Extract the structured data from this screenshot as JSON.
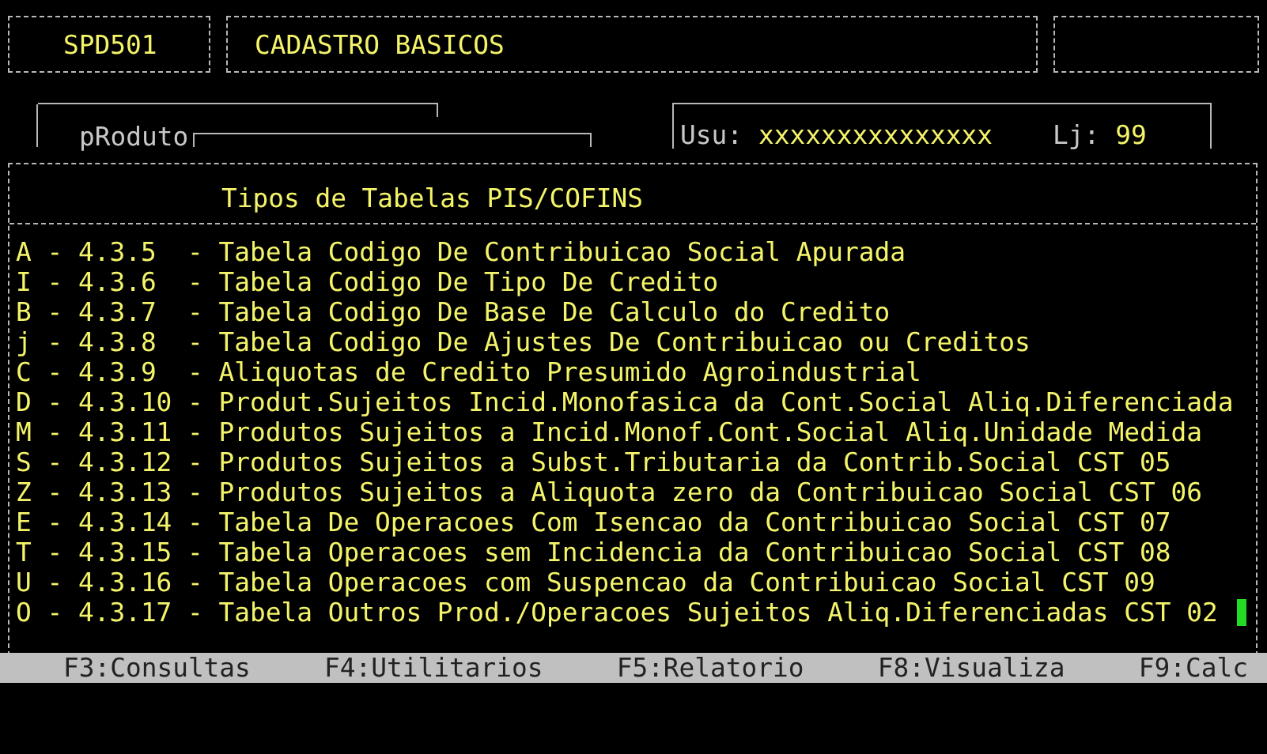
{
  "header": {
    "program_code": "SPD501",
    "screen_title": "CADASTRO BASICOS"
  },
  "product_field": {
    "label": "pRoduto"
  },
  "user_info": {
    "user_label": "Usu:",
    "user": "xxxxxxxxxxxxxxx",
    "store_label": "Lj:",
    "store": "99"
  },
  "menu": {
    "title": "Tipos de Tabelas PIS/COFINS",
    "items": [
      "A - 4.3.5  - Tabela Codigo De Contribuicao Social Apurada",
      "I - 4.3.6  - Tabela Codigo De Tipo De Credito",
      "B - 4.3.7  - Tabela Codigo De Base De Calculo do Credito",
      "j - 4.3.8  - Tabela Codigo De Ajustes De Contribuicao ou Creditos",
      "C - 4.3.9  - Aliquotas de Credito Presumido Agroindustrial",
      "D - 4.3.10 - Produt.Sujeitos Incid.Monofasica da Cont.Social Aliq.Diferenciada",
      "M - 4.3.11 - Produtos Sujeitos a Incid.Monof.Cont.Social Aliq.Unidade Medida",
      "S - 4.3.12 - Produtos Sujeitos a Subst.Tributaria da Contrib.Social CST 05",
      "Z - 4.3.13 - Produtos Sujeitos a Aliquota zero da Contribuicao Social CST 06",
      "E - 4.3.14 - Tabela De Operacoes Com Isencao da Contribuicao Social CST 07",
      "T - 4.3.15 - Tabela Operacoes sem Incidencia da Contribuicao Social CST 08",
      "U - 4.3.16 - Tabela Operacoes com Suspencao da Contribuicao Social CST 09",
      "O - 4.3.17 - Tabela Outros Prod./Operacoes Sujeitos Aliq.Diferenciadas CST 02"
    ]
  },
  "function_keys": [
    "F3:Consultas",
    "F4:Utilitarios",
    "F5:Relatorio",
    "F8:Visualiza",
    "F9:Calc"
  ]
}
